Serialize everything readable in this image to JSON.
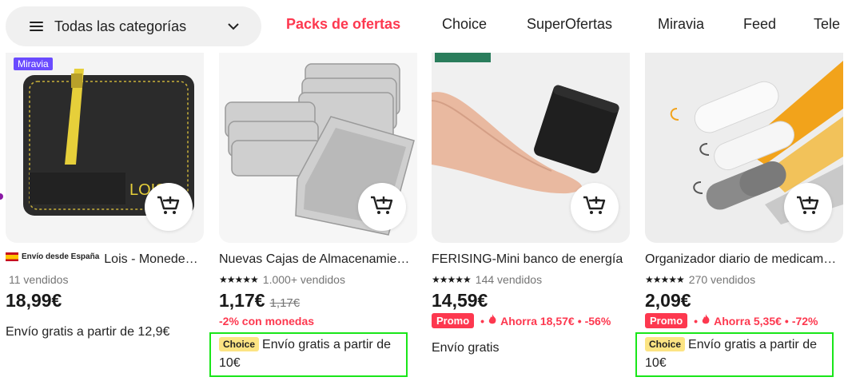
{
  "nav": {
    "categories_label": "Todas las categorías",
    "items": [
      {
        "label": "Packs de ofertas",
        "highlighted": true
      },
      {
        "label": "Choice"
      },
      {
        "label": "SuperOfertas"
      },
      {
        "label": "Miravia"
      },
      {
        "label": "Feed"
      },
      {
        "label": "Tele"
      }
    ]
  },
  "colors": {
    "accent": "#fd384f",
    "choice_badge": "#fce483",
    "miravia_tag": "#6a4bff",
    "highlight_box": "#19e619"
  },
  "products": [
    {
      "tag": "Miravia",
      "shipping_from": "Envío desde España",
      "title": "Lois - Monedero de piel",
      "sold": "11 vendidos",
      "price": "18,99€",
      "shipping": "Envío gratis a partir de 12,9€"
    },
    {
      "title": "Nuevas Cajas de Almacenamiento",
      "rating_stars": 5,
      "sold": "1.000+ vendidos",
      "price": "1,17€",
      "old_price": "1,17€",
      "coins": "-2% con monedas",
      "choice_label": "Choice",
      "shipping": "Envío gratis a partir de 10€"
    },
    {
      "title": "FERISING-Mini banco de energía",
      "rating_stars": 5,
      "sold": "144 vendidos",
      "price": "14,59€",
      "promo_label": "Promo",
      "savings": "Ahorra 18,57€",
      "discount": "-56%",
      "shipping": "Envío gratis"
    },
    {
      "title": "Organizador diario de medicamentos",
      "rating_stars": 5,
      "sold": "270 vendidos",
      "price": "2,09€",
      "promo_label": "Promo",
      "savings": "Ahorra 5,35€",
      "discount": "-72%",
      "choice_label": "Choice",
      "shipping": "Envío gratis a partir de 10€"
    }
  ]
}
